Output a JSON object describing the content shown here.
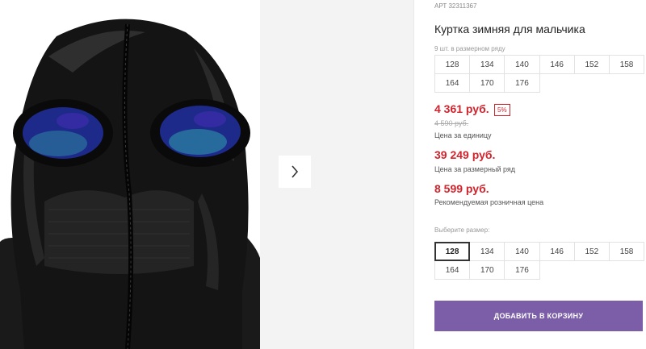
{
  "gallery": {
    "next_icon": "chevron-right-icon"
  },
  "product": {
    "sku_label": "АРТ",
    "sku_value": "32311367",
    "title": "Куртка зимняя для мальчика",
    "size_run_note": "9 шт. в размерном ряду",
    "size_run": [
      "128",
      "134",
      "140",
      "146",
      "152",
      "158",
      "164",
      "170",
      "176"
    ]
  },
  "pricing": {
    "unit_price": "4 361 руб.",
    "discount": "5%",
    "old_price": "4 590 руб.",
    "unit_caption": "Цена за единицу",
    "run_price": "39 249 руб.",
    "run_caption": "Цена за размерный ряд",
    "retail_price": "8 599 руб.",
    "retail_caption": "Рекомендуемая розничная цена"
  },
  "size_picker": {
    "label": "Выберите размер:",
    "selected": "128",
    "options": [
      "128",
      "134",
      "140",
      "146",
      "152",
      "158",
      "164",
      "170",
      "176"
    ]
  },
  "cart": {
    "button_label": "ДОБАВИТЬ В КОРЗИНУ",
    "color": "#7b5ea7"
  }
}
